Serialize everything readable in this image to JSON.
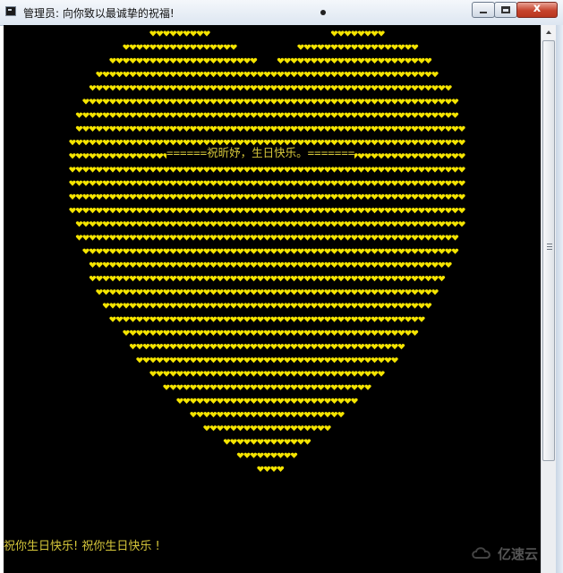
{
  "window": {
    "title": "管理员: 向你致以最诚挚的祝福!",
    "minimize_label": "",
    "maximize_label": "",
    "close_label": "x"
  },
  "console": {
    "banner": "======祝昕妤，生日快乐。=======",
    "footer": "祝你生日快乐! 祝你生日快乐 !",
    "text_color": "#d6c73a",
    "heart_color": "#f5e400",
    "background": "#000000"
  },
  "watermark": {
    "text": "亿速云"
  }
}
